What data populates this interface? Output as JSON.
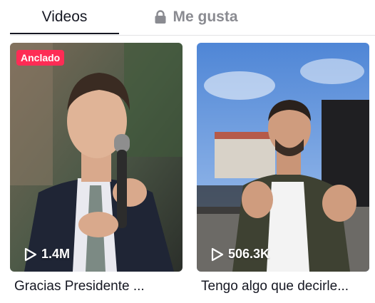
{
  "tabs": {
    "videos_label": "Videos",
    "likes_label": "Me gusta",
    "likes_icon": "lock-icon"
  },
  "colors": {
    "accent": "#fe2c55",
    "active_text": "#161823",
    "inactive_text": "#8a8b91"
  },
  "videos": [
    {
      "badge": "Anclado",
      "views": "1.4M",
      "caption": "Gracias Presidente ..."
    },
    {
      "views": "506.3K",
      "caption": "Tengo algo que decirle..."
    }
  ]
}
